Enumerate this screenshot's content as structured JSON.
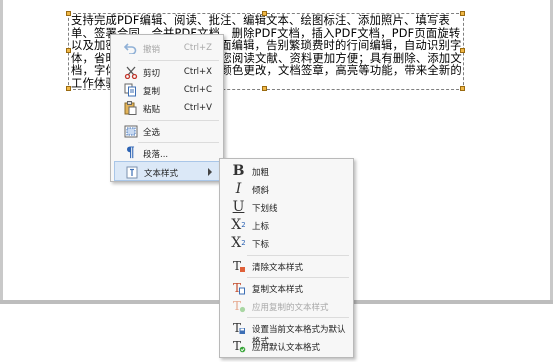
{
  "document": {
    "paragraph": "支持完成PDF编辑、阅读、批注、编辑文本、绘图标注、添加照片、填写表单、签署合同，合并PDF文档，删除PDF文档，插入PDF文档，PDF页面旋转以及加密保护PDF文档等。全面编辑，告别繁琐费时的行间编辑，自动识别字体，省时省力，自由编辑，让您阅读文献、资料更加方便；具有删除、添加文档，字体大小颜色更改，大小颜色更改，文档签章，高亮等功能，带来全新的工作体验。"
  },
  "context_menu": {
    "items": [
      {
        "label": "撤销",
        "shortcut": "Ctrl+Z",
        "icon": "undo-icon",
        "enabled": false
      },
      {
        "label": "剪切",
        "shortcut": "Ctrl+X",
        "icon": "scissors-icon",
        "enabled": true
      },
      {
        "label": "复制",
        "shortcut": "Ctrl+C",
        "icon": "copy-icon",
        "enabled": true
      },
      {
        "label": "粘贴",
        "shortcut": "Ctrl+V",
        "icon": "paste-icon",
        "enabled": true
      },
      {
        "label": "全选",
        "shortcut": "",
        "icon": "select-all-icon",
        "enabled": true
      },
      {
        "label": "段落...",
        "shortcut": "",
        "icon": "paragraph-icon",
        "enabled": true
      },
      {
        "label": "文本样式",
        "shortcut": "",
        "icon": "text-style-icon",
        "enabled": true,
        "has_submenu": true
      }
    ]
  },
  "text_style_submenu": {
    "items": [
      {
        "label": "加粗",
        "glyph": "B",
        "icon": "bold-icon"
      },
      {
        "label": "倾斜",
        "glyph": "I",
        "icon": "italic-icon"
      },
      {
        "label": "下划线",
        "glyph": "U",
        "icon": "underline-icon"
      },
      {
        "label": "上标",
        "glyph": "X",
        "sup": "2",
        "icon": "superscript-icon"
      },
      {
        "label": "下标",
        "glyph": "X",
        "sub": "2",
        "icon": "subscript-icon"
      },
      {
        "label": "清除文本样式",
        "icon": "clear-text-style-icon"
      },
      {
        "label": "复制文本样式",
        "icon": "copy-text-style-icon"
      },
      {
        "label": "应用复制的文本样式",
        "icon": "apply-copied-style-icon",
        "enabled": false
      },
      {
        "label": "设置当前文本格式为默认格式",
        "icon": "set-default-format-icon"
      },
      {
        "label": "应用默认文本格式",
        "icon": "apply-default-format-icon"
      }
    ]
  },
  "colors": {
    "handle_fill": "#f0b847",
    "menu_bg": "#f7f7f7",
    "hover_bg": "#dbe8f7",
    "disabled_text": "#a8a8a8"
  }
}
